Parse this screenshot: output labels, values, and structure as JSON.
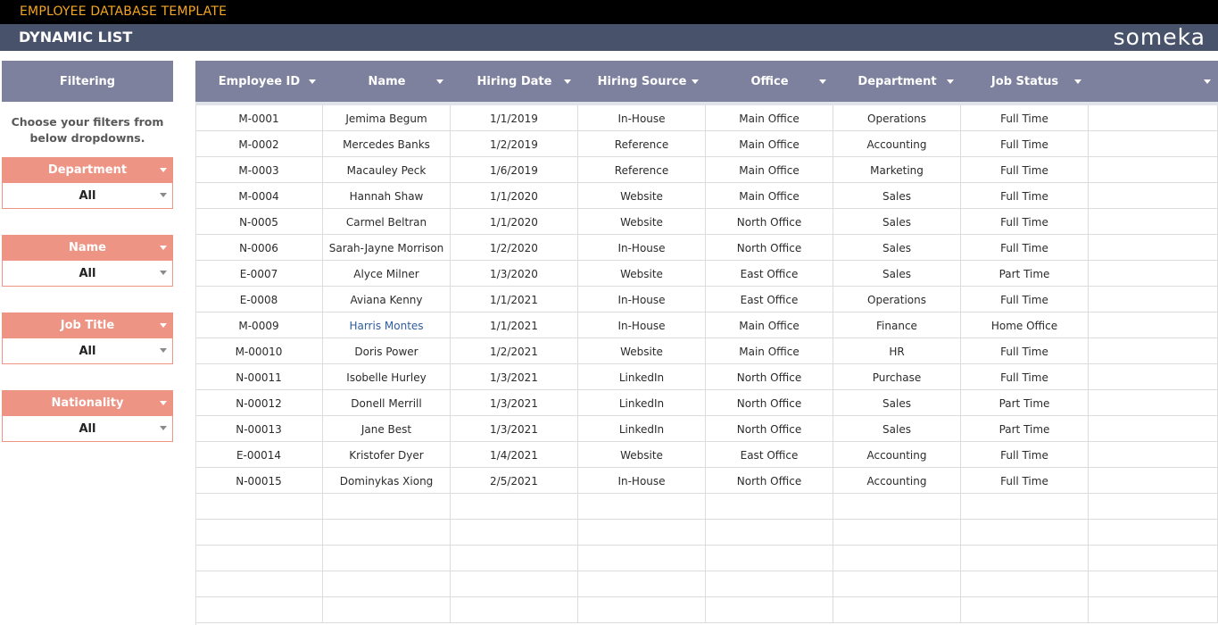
{
  "app": {
    "template_title": "EMPLOYEE DATABASE TEMPLATE",
    "page_title": "DYNAMIC LIST",
    "logo": "someka"
  },
  "sidebar": {
    "header": "Filtering",
    "note_line1": "Choose your filters from",
    "note_line2": "below dropdowns.",
    "filters": [
      {
        "label": "Department",
        "value": "All"
      },
      {
        "label": "Name",
        "value": "All"
      },
      {
        "label": "Job Title",
        "value": "All"
      },
      {
        "label": "Nationality",
        "value": "All"
      }
    ]
  },
  "table": {
    "columns": [
      "Employee ID",
      "Name",
      "Hiring Date",
      "Hiring Source",
      "Office",
      "Department",
      "Job Status",
      ""
    ],
    "rows": [
      [
        "M-0001",
        "Jemima Begum",
        "1/1/2019",
        "In-House",
        "Main Office",
        "Operations",
        "Full Time",
        ""
      ],
      [
        "M-0002",
        "Mercedes Banks",
        "1/2/2019",
        "Reference",
        "Main Office",
        "Accounting",
        "Full Time",
        ""
      ],
      [
        "M-0003",
        "Macauley Peck",
        "1/6/2019",
        "Reference",
        "Main Office",
        "Marketing",
        "Full Time",
        ""
      ],
      [
        "M-0004",
        "Hannah Shaw",
        "1/1/2020",
        "Website",
        "Main Office",
        "Sales",
        "Full Time",
        ""
      ],
      [
        "N-0005",
        "Carmel Beltran",
        "1/1/2020",
        "Website",
        "North Office",
        "Sales",
        "Full Time",
        ""
      ],
      [
        "N-0006",
        "Sarah-Jayne Morrison",
        "1/2/2020",
        "In-House",
        "North Office",
        "Sales",
        "Full Time",
        ""
      ],
      [
        "E-0007",
        "Alyce Milner",
        "1/3/2020",
        "Website",
        "East Office",
        "Sales",
        "Part Time",
        ""
      ],
      [
        "E-0008",
        "Aviana Kenny",
        "1/1/2021",
        "In-House",
        "East Office",
        "Operations",
        "Full Time",
        ""
      ],
      [
        "M-0009",
        "Harris Montes",
        "1/1/2021",
        "In-House",
        "Main Office",
        "Finance",
        "Home Office",
        ""
      ],
      [
        "M-00010",
        "Doris Power",
        "1/2/2021",
        "Website",
        "Main Office",
        "HR",
        "Full Time",
        ""
      ],
      [
        "N-00011",
        "Isobelle Hurley",
        "1/3/2021",
        "LinkedIn",
        "North Office",
        "Purchase",
        "Full Time",
        ""
      ],
      [
        "N-00012",
        "Donell Merrill",
        "1/3/2021",
        "LinkedIn",
        "North Office",
        "Sales",
        "Part Time",
        ""
      ],
      [
        "N-00013",
        "Jane Best",
        "1/3/2021",
        "LinkedIn",
        "North Office",
        "Sales",
        "Part Time",
        ""
      ],
      [
        "E-00014",
        "Kristofer Dyer",
        "1/4/2021",
        "Website",
        "East Office",
        "Accounting",
        "Full Time",
        ""
      ],
      [
        "N-00015",
        "Dominykas Xiong",
        "2/5/2021",
        "In-House",
        "North Office",
        "Accounting",
        "Full Time",
        ""
      ],
      [
        "",
        "",
        "",
        "",
        "",
        "",
        "",
        ""
      ],
      [
        "",
        "",
        "",
        "",
        "",
        "",
        "",
        ""
      ],
      [
        "",
        "",
        "",
        "",
        "",
        "",
        "",
        ""
      ],
      [
        "",
        "",
        "",
        "",
        "",
        "",
        "",
        ""
      ],
      [
        "",
        "",
        "",
        "",
        "",
        "",
        "",
        ""
      ]
    ],
    "highlighted_row": 8
  },
  "colors": {
    "topbar": "#000000",
    "title_accent": "#f5a623",
    "subbar": "#48536b",
    "header_bg": "#7e819d",
    "filter_bg": "#ee9484"
  }
}
